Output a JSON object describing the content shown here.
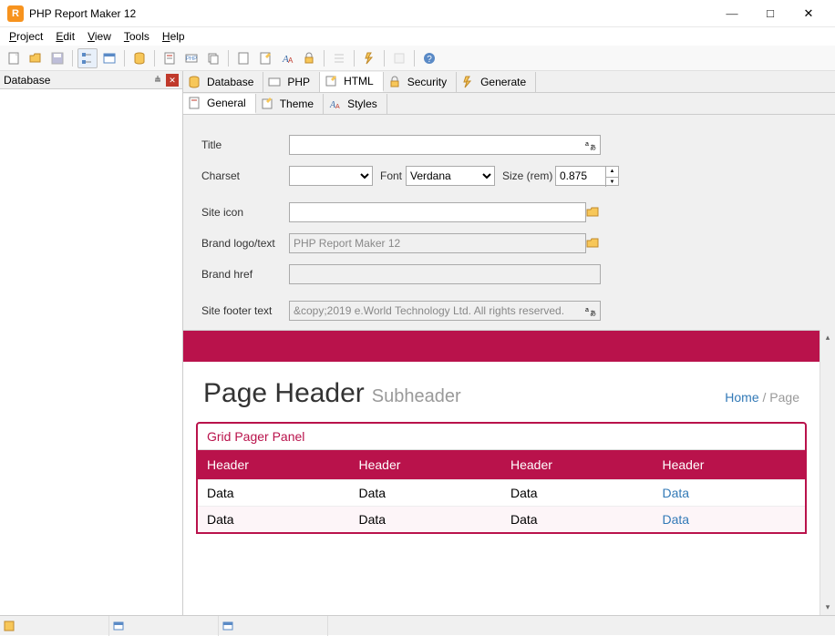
{
  "app": {
    "title": "PHP Report Maker 12",
    "icon_letter": "R"
  },
  "menubar": [
    "Project",
    "Edit",
    "View",
    "Tools",
    "Help"
  ],
  "sidebar": {
    "title": "Database"
  },
  "main_tabs": [
    {
      "label": "Database",
      "icon": "database"
    },
    {
      "label": "PHP",
      "icon": "php"
    },
    {
      "label": "HTML",
      "icon": "html"
    },
    {
      "label": "Security",
      "icon": "lock"
    },
    {
      "label": "Generate",
      "icon": "bolt"
    }
  ],
  "sub_tabs": [
    {
      "label": "General",
      "icon": "page"
    },
    {
      "label": "Theme",
      "icon": "theme"
    },
    {
      "label": "Styles",
      "icon": "styles"
    }
  ],
  "form": {
    "title_label": "Title",
    "title_value": "",
    "charset_label": "Charset",
    "charset_value": "",
    "font_label": "Font",
    "font_value": "Verdana",
    "size_label": "Size (rem)",
    "size_value": "0.875",
    "siteicon_label": "Site icon",
    "siteicon_value": "",
    "brandlogo_label": "Brand logo/text",
    "brandlogo_value": "PHP Report Maker 12",
    "brandhref_label": "Brand href",
    "brandhref_value": "",
    "footer_label": "Site footer text",
    "footer_value": "&copy;2019 e.World Technology Ltd. All rights reserved."
  },
  "preview": {
    "page_header": "Page Header",
    "subheader": "Subheader",
    "breadcrumb_home": "Home",
    "breadcrumb_sep": " / ",
    "breadcrumb_page": "Page",
    "grid_panel": "Grid Pager Panel",
    "headers": [
      "Header",
      "Header",
      "Header",
      "Header"
    ],
    "rows": [
      [
        "Data",
        "Data",
        "Data",
        "Data"
      ],
      [
        "Data",
        "Data",
        "Data",
        "Data"
      ]
    ]
  }
}
